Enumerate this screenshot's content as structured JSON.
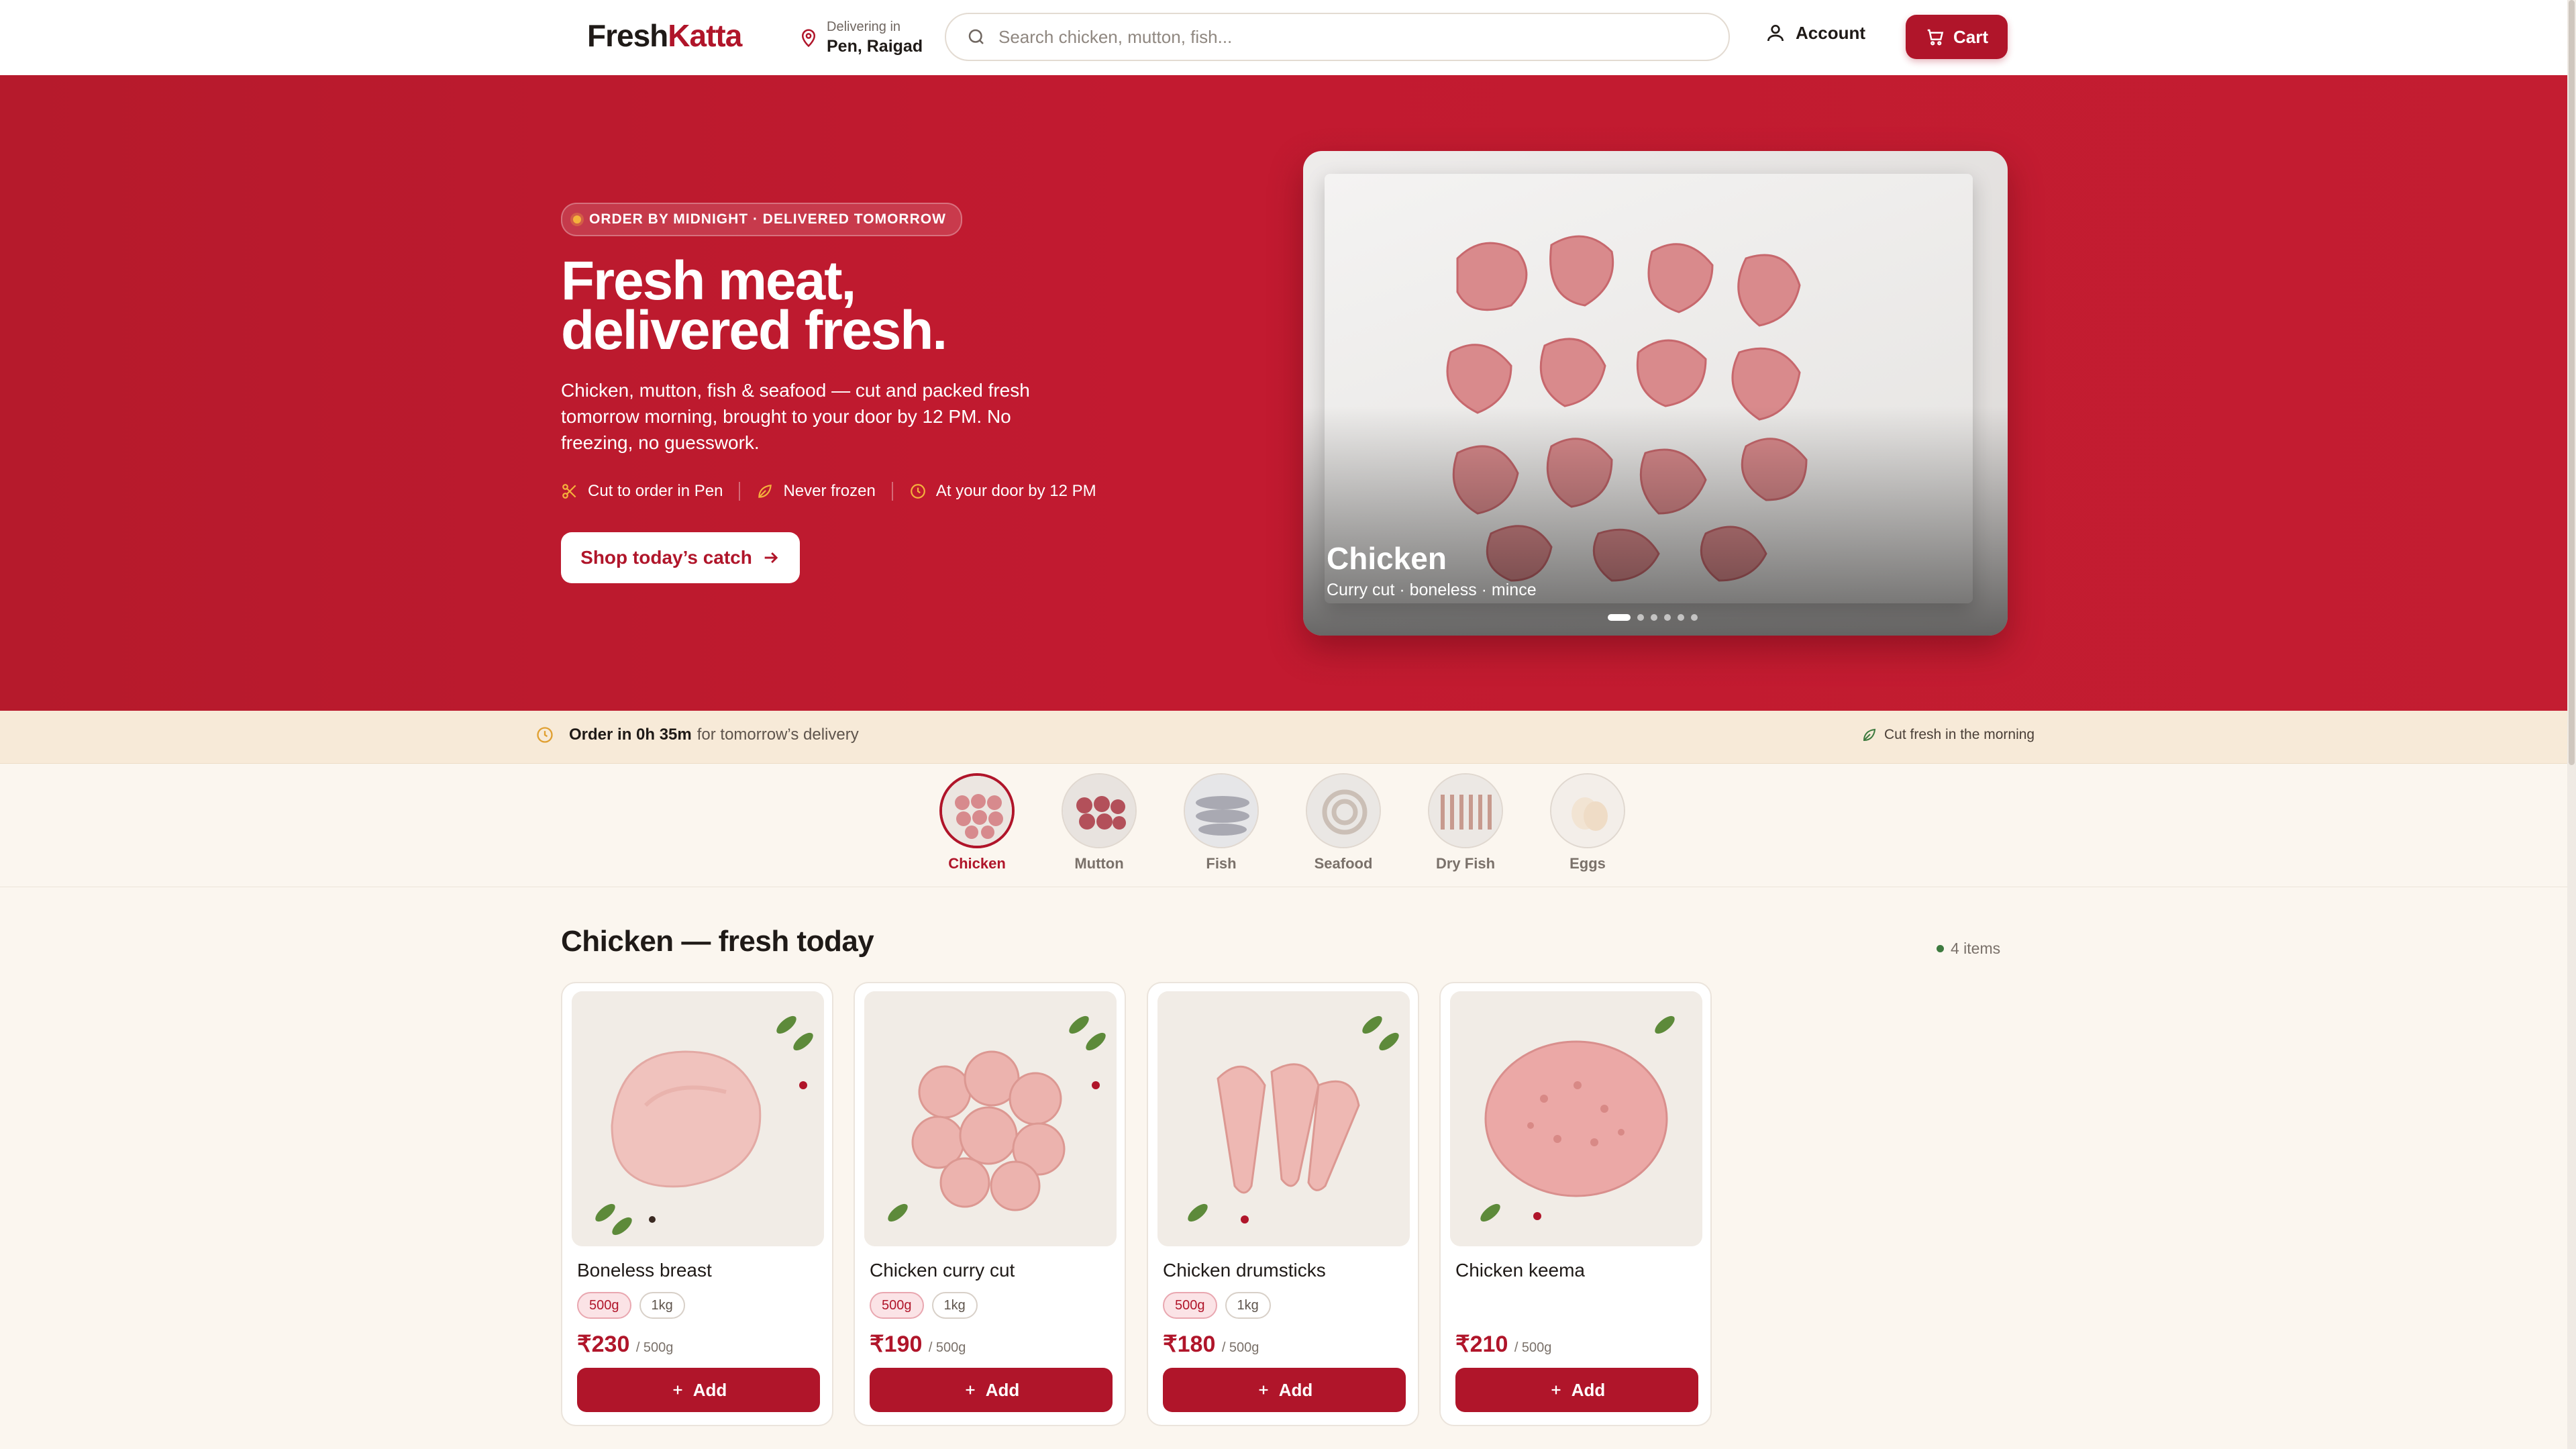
{
  "header": {
    "logo_part1": "Fresh",
    "logo_part2": "Katta",
    "delivering_label": "Delivering in",
    "location": "Pen, Raigad",
    "search_placeholder": "Search chicken, mutton, fish...",
    "account_label": "Account",
    "cart_label": "Cart"
  },
  "hero": {
    "badge": "ORDER BY MIDNIGHT · DELIVERED TOMORROW",
    "title_line1": "Fresh meat,",
    "title_line2": "delivered fresh.",
    "description": "Chicken, mutton, fish & seafood — cut and packed fresh tomorrow morning, brought to your door by 12 PM. No freezing, no guesswork.",
    "features": [
      "Cut to order in Pen",
      "Never frozen",
      "At your door by 12 PM"
    ],
    "cta": "Shop today’s catch",
    "carousel": {
      "title": "Chicken",
      "subtitle": "Curry cut · boneless · mince",
      "slide_count": 6,
      "active_slide": 1
    }
  },
  "infobar": {
    "order_prefix": "Order in 0h 35m",
    "order_suffix": "for tomorrow’s delivery",
    "right_text": "Cut fresh in the morning"
  },
  "categories": [
    {
      "label": "Chicken",
      "active": true
    },
    {
      "label": "Mutton",
      "active": false
    },
    {
      "label": "Fish",
      "active": false
    },
    {
      "label": "Seafood",
      "active": false
    },
    {
      "label": "Dry Fish",
      "active": false
    },
    {
      "label": "Eggs",
      "active": false
    }
  ],
  "section": {
    "title": "Chicken — fresh today",
    "count": "4 items"
  },
  "products": [
    {
      "name": "Boneless breast",
      "sizes": [
        "500g",
        "1kg"
      ],
      "price": "₹230",
      "unit": "/ 500g",
      "add": "Add"
    },
    {
      "name": "Chicken curry cut",
      "sizes": [
        "500g",
        "1kg"
      ],
      "price": "₹190",
      "unit": "/ 500g",
      "add": "Add"
    },
    {
      "name": "Chicken drumsticks",
      "sizes": [
        "500g",
        "1kg"
      ],
      "price": "₹180",
      "unit": "/ 500g",
      "add": "Add"
    },
    {
      "name": "Chicken keema",
      "sizes": [],
      "price": "₹210",
      "unit": "/ 500g",
      "add": "Add"
    }
  ],
  "colors": {
    "brand": "#b0152a",
    "hero_bg": "#c21a30",
    "page_bg": "#fbf6ef",
    "infobar_bg": "#f7ead8"
  }
}
